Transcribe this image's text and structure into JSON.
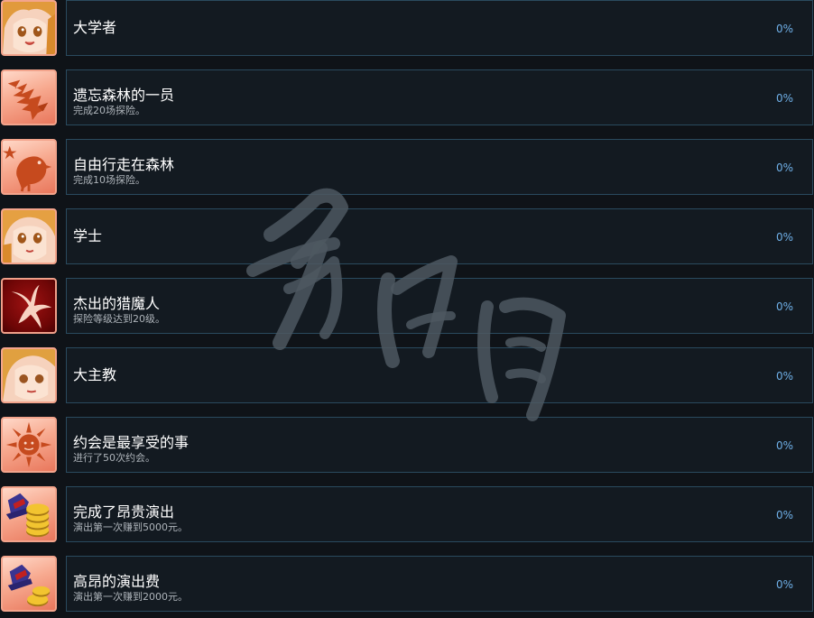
{
  "achievements": [
    {
      "title": "大学者",
      "desc": "",
      "percent": "0%",
      "icon": "girl-portrait-icon"
    },
    {
      "title": "遗忘森林的一员",
      "desc": "完成20场探险。",
      "percent": "0%",
      "icon": "eagle-icon"
    },
    {
      "title": "自由行走在森林",
      "desc": "完成10场探险。",
      "percent": "0%",
      "icon": "bird-icon"
    },
    {
      "title": "学士",
      "desc": "",
      "percent": "0%",
      "icon": "girl-portrait-icon"
    },
    {
      "title": "杰出的猎魔人",
      "desc": "探险等级达到20级。",
      "percent": "0%",
      "icon": "claw-mark-icon"
    },
    {
      "title": "大主教",
      "desc": "",
      "percent": "0%",
      "icon": "girl-portrait-icon"
    },
    {
      "title": "约会是最享受的事",
      "desc": "进行了50次约会。",
      "percent": "0%",
      "icon": "sun-icon"
    },
    {
      "title": "完成了昂贵演出",
      "desc": "演出第一次赚到5000元。",
      "percent": "0%",
      "icon": "hat-and-coins-icon"
    },
    {
      "title": "高昂的演出费",
      "desc": "演出第一次赚到2000元。",
      "percent": "0%",
      "icon": "hat-and-coins-icon"
    }
  ],
  "colors": {
    "background": "#0f1318",
    "card_border": "#2a4a5e",
    "percent_text": "#6fb0e8",
    "icon_orange": "#c64a1e"
  }
}
